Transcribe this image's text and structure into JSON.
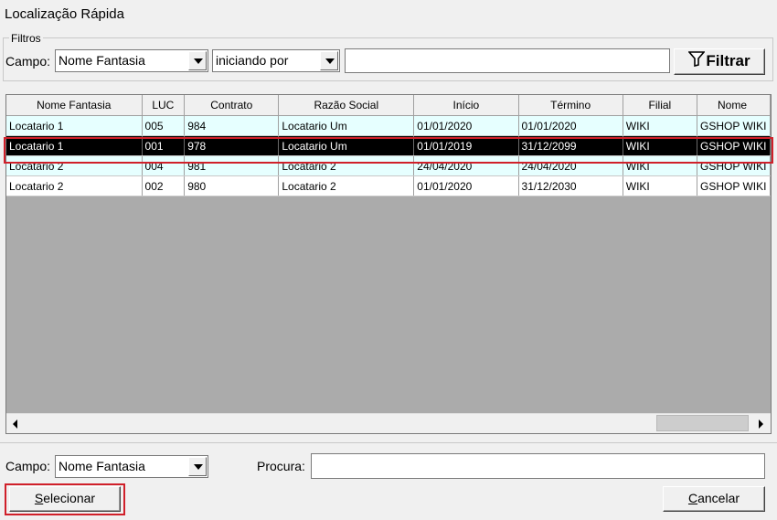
{
  "window": {
    "title": "Localização Rápida"
  },
  "filters": {
    "legend": "Filtros",
    "campo_label": "Campo:",
    "campo_value": "Nome Fantasia",
    "mode_value": "iniciando por",
    "text_value": "",
    "filter_button": "Filtrar"
  },
  "grid": {
    "columns": [
      "Nome Fantasia",
      "LUC",
      "Contrato",
      "Razão Social",
      "Início",
      "Término",
      "Filial",
      "Nome"
    ],
    "rows": [
      [
        "Locatario 1",
        "005",
        "984",
        "Locatario Um",
        "01/01/2020",
        "01/01/2020",
        "WIKI",
        "GSHOP WIKI"
      ],
      [
        "Locatario 1",
        "001",
        "978",
        "Locatario Um",
        "01/01/2019",
        "31/12/2099",
        "WIKI",
        "GSHOP WIKI"
      ],
      [
        "Locatario 2",
        "004",
        "981",
        "Locatario 2",
        "24/04/2020",
        "24/04/2020",
        "WIKI",
        "GSHOP WIKI"
      ],
      [
        "Locatario 2",
        "002",
        "980",
        "Locatario 2",
        "01/01/2020",
        "31/12/2030",
        "WIKI",
        "GSHOP WIKI"
      ]
    ],
    "selected_row": 1
  },
  "bottom": {
    "campo_label": "Campo:",
    "campo_value": "Nome Fantasia",
    "procura_label": "Procura:",
    "procura_value": "",
    "select_button_first": "S",
    "select_button_rest": "elecionar",
    "cancel_button_first": "C",
    "cancel_button_rest": "ancelar"
  },
  "colors": {
    "highlight_outline": "#d0202a",
    "selected_row_bg": "#000000",
    "alt_row_bg": "#e6ffff"
  }
}
